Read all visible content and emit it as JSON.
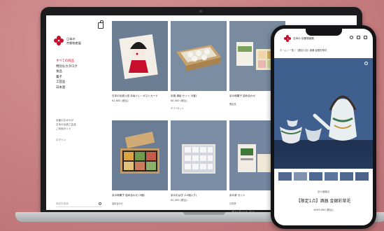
{
  "laptop": {
    "model_label": "MacBook Pro",
    "site": {
      "brand_lines": [
        "日本の",
        "京都物産展"
      ],
      "nav": [
        "すべての商品",
        "特別なカタログ",
        "食品",
        "菓子",
        "工芸品",
        "日本酒"
      ],
      "subnav": [
        "京都のおみやげ",
        "日本の伝統工芸品",
        "ご利用ガイド"
      ],
      "login": "ログイン",
      "search_placeholder": "商品を検索"
    },
    "products": [
      {
        "title": "日本の伝統人形 手ぬぐい・ポストカード",
        "price": "¥1,650 (税込)",
        "tag": ""
      },
      {
        "title": "京焼 湯呑 セット (5客)",
        "price": "¥5,500 (税込)",
        "tag": "ギフトセット"
      },
      {
        "title": "京の和菓子 詰め合わせ",
        "price": "",
        "tag": "限定品"
      },
      {
        "title": "京の和菓子 詰め合わせ (9個)",
        "price": "",
        "tag": "詰め合わせ"
      },
      {
        "title": "京のおはぎ (12個入り)",
        "price": "¥2,200 (税込)",
        "tag": ""
      },
      {
        "title": "京の茶 セット",
        "price": "",
        "tag": "日本茶"
      }
    ]
  },
  "phone": {
    "brand": "日本の 京都物産展",
    "breadcrumb": "ホーム  /  一覧  /  【限定1点】酒器 金銀彩草花",
    "shop_name": "京の酒器店",
    "product_title": "【限定1点】酒器 金銀彩草花",
    "price": "¥209,000 (税込)",
    "thumbnail_count": 6
  }
}
